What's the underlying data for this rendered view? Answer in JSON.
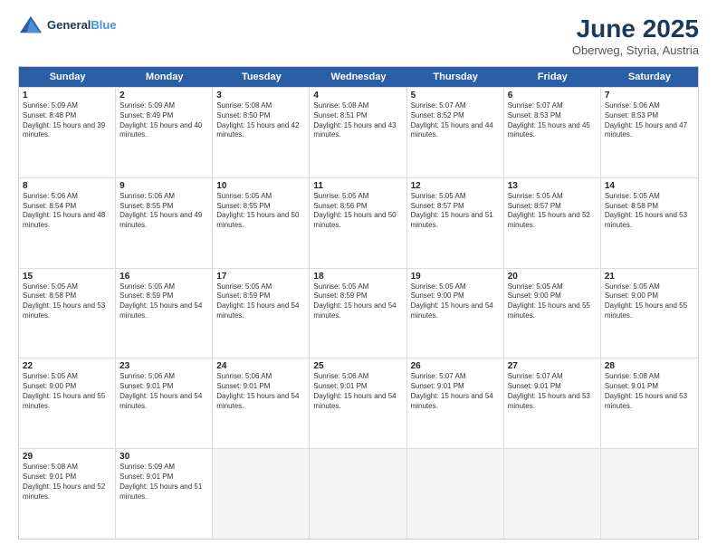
{
  "header": {
    "logo_line1": "General",
    "logo_line2": "Blue",
    "month": "June 2025",
    "location": "Oberweg, Styria, Austria"
  },
  "days_of_week": [
    "Sunday",
    "Monday",
    "Tuesday",
    "Wednesday",
    "Thursday",
    "Friday",
    "Saturday"
  ],
  "weeks": [
    [
      {
        "day": 1,
        "sunrise": "Sunrise: 5:09 AM",
        "sunset": "Sunset: 8:48 PM",
        "daylight": "Daylight: 15 hours and 39 minutes."
      },
      {
        "day": 2,
        "sunrise": "Sunrise: 5:09 AM",
        "sunset": "Sunset: 8:49 PM",
        "daylight": "Daylight: 15 hours and 40 minutes."
      },
      {
        "day": 3,
        "sunrise": "Sunrise: 5:08 AM",
        "sunset": "Sunset: 8:50 PM",
        "daylight": "Daylight: 15 hours and 42 minutes."
      },
      {
        "day": 4,
        "sunrise": "Sunrise: 5:08 AM",
        "sunset": "Sunset: 8:51 PM",
        "daylight": "Daylight: 15 hours and 43 minutes."
      },
      {
        "day": 5,
        "sunrise": "Sunrise: 5:07 AM",
        "sunset": "Sunset: 8:52 PM",
        "daylight": "Daylight: 15 hours and 44 minutes."
      },
      {
        "day": 6,
        "sunrise": "Sunrise: 5:07 AM",
        "sunset": "Sunset: 8:53 PM",
        "daylight": "Daylight: 15 hours and 45 minutes."
      },
      {
        "day": 7,
        "sunrise": "Sunrise: 5:06 AM",
        "sunset": "Sunset: 8:53 PM",
        "daylight": "Daylight: 15 hours and 47 minutes."
      }
    ],
    [
      {
        "day": 8,
        "sunrise": "Sunrise: 5:06 AM",
        "sunset": "Sunset: 8:54 PM",
        "daylight": "Daylight: 15 hours and 48 minutes."
      },
      {
        "day": 9,
        "sunrise": "Sunrise: 5:06 AM",
        "sunset": "Sunset: 8:55 PM",
        "daylight": "Daylight: 15 hours and 49 minutes."
      },
      {
        "day": 10,
        "sunrise": "Sunrise: 5:05 AM",
        "sunset": "Sunset: 8:55 PM",
        "daylight": "Daylight: 15 hours and 50 minutes."
      },
      {
        "day": 11,
        "sunrise": "Sunrise: 5:05 AM",
        "sunset": "Sunset: 8:56 PM",
        "daylight": "Daylight: 15 hours and 50 minutes."
      },
      {
        "day": 12,
        "sunrise": "Sunrise: 5:05 AM",
        "sunset": "Sunset: 8:57 PM",
        "daylight": "Daylight: 15 hours and 51 minutes."
      },
      {
        "day": 13,
        "sunrise": "Sunrise: 5:05 AM",
        "sunset": "Sunset: 8:57 PM",
        "daylight": "Daylight: 15 hours and 52 minutes."
      },
      {
        "day": 14,
        "sunrise": "Sunrise: 5:05 AM",
        "sunset": "Sunset: 8:58 PM",
        "daylight": "Daylight: 15 hours and 53 minutes."
      }
    ],
    [
      {
        "day": 15,
        "sunrise": "Sunrise: 5:05 AM",
        "sunset": "Sunset: 8:58 PM",
        "daylight": "Daylight: 15 hours and 53 minutes."
      },
      {
        "day": 16,
        "sunrise": "Sunrise: 5:05 AM",
        "sunset": "Sunset: 8:59 PM",
        "daylight": "Daylight: 15 hours and 54 minutes."
      },
      {
        "day": 17,
        "sunrise": "Sunrise: 5:05 AM",
        "sunset": "Sunset: 8:59 PM",
        "daylight": "Daylight: 15 hours and 54 minutes."
      },
      {
        "day": 18,
        "sunrise": "Sunrise: 5:05 AM",
        "sunset": "Sunset: 8:59 PM",
        "daylight": "Daylight: 15 hours and 54 minutes."
      },
      {
        "day": 19,
        "sunrise": "Sunrise: 5:05 AM",
        "sunset": "Sunset: 9:00 PM",
        "daylight": "Daylight: 15 hours and 54 minutes."
      },
      {
        "day": 20,
        "sunrise": "Sunrise: 5:05 AM",
        "sunset": "Sunset: 9:00 PM",
        "daylight": "Daylight: 15 hours and 55 minutes."
      },
      {
        "day": 21,
        "sunrise": "Sunrise: 5:05 AM",
        "sunset": "Sunset: 9:00 PM",
        "daylight": "Daylight: 15 hours and 55 minutes."
      }
    ],
    [
      {
        "day": 22,
        "sunrise": "Sunrise: 5:05 AM",
        "sunset": "Sunset: 9:00 PM",
        "daylight": "Daylight: 15 hours and 55 minutes."
      },
      {
        "day": 23,
        "sunrise": "Sunrise: 5:06 AM",
        "sunset": "Sunset: 9:01 PM",
        "daylight": "Daylight: 15 hours and 54 minutes."
      },
      {
        "day": 24,
        "sunrise": "Sunrise: 5:06 AM",
        "sunset": "Sunset: 9:01 PM",
        "daylight": "Daylight: 15 hours and 54 minutes."
      },
      {
        "day": 25,
        "sunrise": "Sunrise: 5:06 AM",
        "sunset": "Sunset: 9:01 PM",
        "daylight": "Daylight: 15 hours and 54 minutes."
      },
      {
        "day": 26,
        "sunrise": "Sunrise: 5:07 AM",
        "sunset": "Sunset: 9:01 PM",
        "daylight": "Daylight: 15 hours and 54 minutes."
      },
      {
        "day": 27,
        "sunrise": "Sunrise: 5:07 AM",
        "sunset": "Sunset: 9:01 PM",
        "daylight": "Daylight: 15 hours and 53 minutes."
      },
      {
        "day": 28,
        "sunrise": "Sunrise: 5:08 AM",
        "sunset": "Sunset: 9:01 PM",
        "daylight": "Daylight: 15 hours and 53 minutes."
      }
    ],
    [
      {
        "day": 29,
        "sunrise": "Sunrise: 5:08 AM",
        "sunset": "Sunset: 9:01 PM",
        "daylight": "Daylight: 15 hours and 52 minutes."
      },
      {
        "day": 30,
        "sunrise": "Sunrise: 5:09 AM",
        "sunset": "Sunset: 9:01 PM",
        "daylight": "Daylight: 15 hours and 51 minutes."
      },
      null,
      null,
      null,
      null,
      null
    ]
  ]
}
